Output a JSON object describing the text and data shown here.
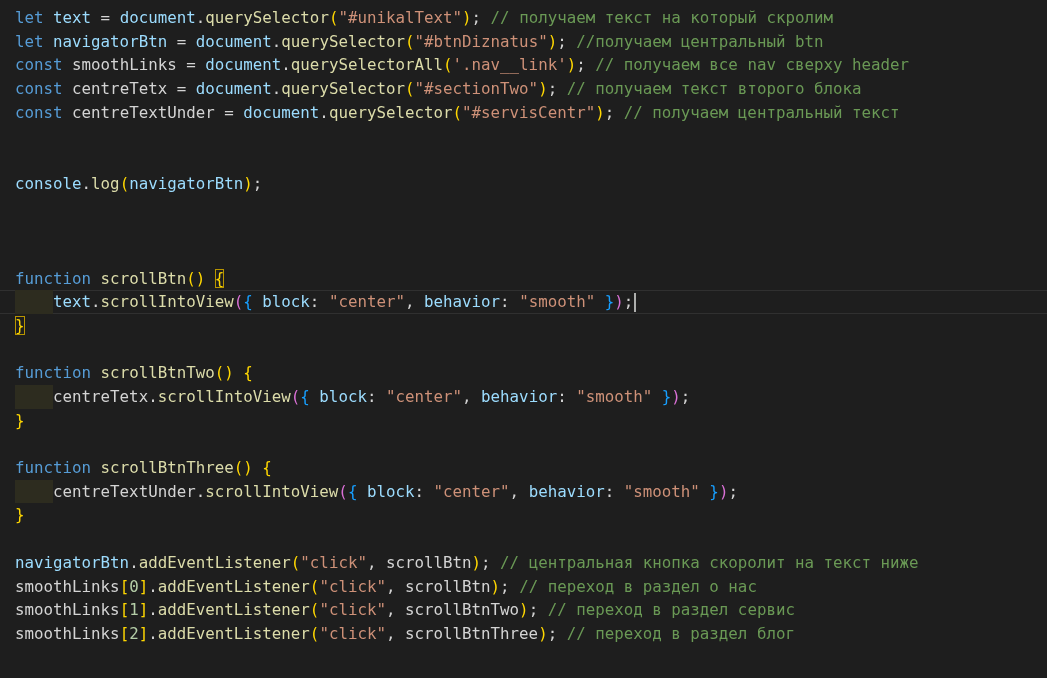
{
  "editor": {
    "lines": [
      {
        "kind": "code",
        "tokens": [
          {
            "kind": "kw",
            "text": "let "
          },
          {
            "kind": "var",
            "text": "text"
          },
          {
            "kind": "plain",
            "text": " = "
          },
          {
            "kind": "var",
            "text": "document"
          },
          {
            "kind": "plain",
            "text": "."
          },
          {
            "kind": "fn",
            "text": "querySelector"
          },
          {
            "kind": "b1",
            "text": "("
          },
          {
            "kind": "str",
            "text": "\"#unikalText\""
          },
          {
            "kind": "b1",
            "text": ")"
          },
          {
            "kind": "plain",
            "text": "; "
          },
          {
            "kind": "com",
            "text": "// получаем текст на который скролим"
          }
        ]
      },
      {
        "kind": "code",
        "tokens": [
          {
            "kind": "kw",
            "text": "let "
          },
          {
            "kind": "var",
            "text": "navigatorBtn"
          },
          {
            "kind": "plain",
            "text": " = "
          },
          {
            "kind": "var",
            "text": "document"
          },
          {
            "kind": "plain",
            "text": "."
          },
          {
            "kind": "fn",
            "text": "querySelector"
          },
          {
            "kind": "b1",
            "text": "("
          },
          {
            "kind": "str",
            "text": "\"#btnDiznatus\""
          },
          {
            "kind": "b1",
            "text": ")"
          },
          {
            "kind": "plain",
            "text": "; "
          },
          {
            "kind": "com",
            "text": "//получаем центральный btn"
          }
        ]
      },
      {
        "kind": "code",
        "tokens": [
          {
            "kind": "kw",
            "text": "const"
          },
          {
            "kind": "plain",
            "text": " smoothLinks = "
          },
          {
            "kind": "var",
            "text": "document"
          },
          {
            "kind": "plain",
            "text": "."
          },
          {
            "kind": "fn",
            "text": "querySelectorAll"
          },
          {
            "kind": "b1",
            "text": "("
          },
          {
            "kind": "str",
            "text": "'.nav__link'"
          },
          {
            "kind": "b1",
            "text": ")"
          },
          {
            "kind": "plain",
            "text": "; "
          },
          {
            "kind": "com",
            "text": "// получаем все nav сверху header"
          }
        ]
      },
      {
        "kind": "code",
        "tokens": [
          {
            "kind": "kw",
            "text": "const"
          },
          {
            "kind": "plain",
            "text": " centreTetx = "
          },
          {
            "kind": "var",
            "text": "document"
          },
          {
            "kind": "plain",
            "text": "."
          },
          {
            "kind": "fn",
            "text": "querySelector"
          },
          {
            "kind": "b1",
            "text": "("
          },
          {
            "kind": "str",
            "text": "\"#sectionTwo\""
          },
          {
            "kind": "b1",
            "text": ")"
          },
          {
            "kind": "plain",
            "text": "; "
          },
          {
            "kind": "com",
            "text": "// получаем текст второго блока"
          }
        ]
      },
      {
        "kind": "code",
        "tokens": [
          {
            "kind": "kw",
            "text": "const"
          },
          {
            "kind": "plain",
            "text": " centreTextUnder = "
          },
          {
            "kind": "var",
            "text": "document"
          },
          {
            "kind": "plain",
            "text": "."
          },
          {
            "kind": "fn",
            "text": "querySelector"
          },
          {
            "kind": "b1",
            "text": "("
          },
          {
            "kind": "str",
            "text": "\"#servisCentr\""
          },
          {
            "kind": "b1",
            "text": ")"
          },
          {
            "kind": "plain",
            "text": "; "
          },
          {
            "kind": "com",
            "text": "// получаем центральный текст"
          }
        ]
      },
      {
        "kind": "blank"
      },
      {
        "kind": "blank"
      },
      {
        "kind": "code",
        "tokens": [
          {
            "kind": "var",
            "text": "console"
          },
          {
            "kind": "plain",
            "text": "."
          },
          {
            "kind": "fn",
            "text": "log"
          },
          {
            "kind": "b1",
            "text": "("
          },
          {
            "kind": "var",
            "text": "navigatorBtn"
          },
          {
            "kind": "b1",
            "text": ")"
          },
          {
            "kind": "plain",
            "text": ";"
          }
        ]
      },
      {
        "kind": "blank"
      },
      {
        "kind": "blank"
      },
      {
        "kind": "blank"
      },
      {
        "kind": "code",
        "tokens": [
          {
            "kind": "kw",
            "text": "function "
          },
          {
            "kind": "fn",
            "text": "scrollBtn"
          },
          {
            "kind": "b1",
            "text": "() "
          },
          {
            "kind": "b1",
            "text": "{",
            "matched": true
          }
        ]
      },
      {
        "kind": "code",
        "indented": true,
        "current": true,
        "tokens": [
          {
            "kind": "var",
            "text": "text"
          },
          {
            "kind": "plain",
            "text": "."
          },
          {
            "kind": "fn",
            "text": "scrollIntoView"
          },
          {
            "kind": "b2",
            "text": "("
          },
          {
            "kind": "b3",
            "text": "{ "
          },
          {
            "kind": "var",
            "text": "block"
          },
          {
            "kind": "plain",
            "text": ": "
          },
          {
            "kind": "str",
            "text": "\"center\""
          },
          {
            "kind": "plain",
            "text": ", "
          },
          {
            "kind": "var",
            "text": "behavior"
          },
          {
            "kind": "plain",
            "text": ": "
          },
          {
            "kind": "str",
            "text": "\"smooth\" "
          },
          {
            "kind": "b3",
            "text": "}"
          },
          {
            "kind": "b2",
            "text": ")"
          },
          {
            "kind": "plain",
            "text": ";"
          }
        ]
      },
      {
        "kind": "code",
        "tokens": [
          {
            "kind": "b1",
            "text": "}",
            "matched": true
          }
        ]
      },
      {
        "kind": "blank"
      },
      {
        "kind": "code",
        "tokens": [
          {
            "kind": "kw",
            "text": "function "
          },
          {
            "kind": "fn",
            "text": "scrollBtnTwo"
          },
          {
            "kind": "b1",
            "text": "() {"
          }
        ]
      },
      {
        "kind": "code",
        "indented": true,
        "tokens": [
          {
            "kind": "plain",
            "text": "centreTetx."
          },
          {
            "kind": "fn",
            "text": "scrollIntoView"
          },
          {
            "kind": "b2",
            "text": "("
          },
          {
            "kind": "b3",
            "text": "{ "
          },
          {
            "kind": "var",
            "text": "block"
          },
          {
            "kind": "plain",
            "text": ": "
          },
          {
            "kind": "str",
            "text": "\"center\""
          },
          {
            "kind": "plain",
            "text": ", "
          },
          {
            "kind": "var",
            "text": "behavior"
          },
          {
            "kind": "plain",
            "text": ": "
          },
          {
            "kind": "str",
            "text": "\"smooth\" "
          },
          {
            "kind": "b3",
            "text": "}"
          },
          {
            "kind": "b2",
            "text": ")"
          },
          {
            "kind": "plain",
            "text": ";"
          }
        ]
      },
      {
        "kind": "code",
        "tokens": [
          {
            "kind": "b1",
            "text": "}"
          }
        ]
      },
      {
        "kind": "blank"
      },
      {
        "kind": "code",
        "tokens": [
          {
            "kind": "kw",
            "text": "function "
          },
          {
            "kind": "fn",
            "text": "scrollBtnThree"
          },
          {
            "kind": "b1",
            "text": "() {"
          }
        ]
      },
      {
        "kind": "code",
        "indented": true,
        "tokens": [
          {
            "kind": "plain",
            "text": "centreTextUnder."
          },
          {
            "kind": "fn",
            "text": "scrollIntoView"
          },
          {
            "kind": "b2",
            "text": "("
          },
          {
            "kind": "b3",
            "text": "{ "
          },
          {
            "kind": "var",
            "text": "block"
          },
          {
            "kind": "plain",
            "text": ": "
          },
          {
            "kind": "str",
            "text": "\"center\""
          },
          {
            "kind": "plain",
            "text": ", "
          },
          {
            "kind": "var",
            "text": "behavior"
          },
          {
            "kind": "plain",
            "text": ": "
          },
          {
            "kind": "str",
            "text": "\"smooth\" "
          },
          {
            "kind": "b3",
            "text": "}"
          },
          {
            "kind": "b2",
            "text": ")"
          },
          {
            "kind": "plain",
            "text": ";"
          }
        ]
      },
      {
        "kind": "code",
        "tokens": [
          {
            "kind": "b1",
            "text": "}"
          }
        ]
      },
      {
        "kind": "blank"
      },
      {
        "kind": "code",
        "tokens": [
          {
            "kind": "var",
            "text": "navigatorBtn"
          },
          {
            "kind": "plain",
            "text": "."
          },
          {
            "kind": "fn",
            "text": "addEventListener"
          },
          {
            "kind": "b1",
            "text": "("
          },
          {
            "kind": "str",
            "text": "\"click\""
          },
          {
            "kind": "plain",
            "text": ", scrollBtn"
          },
          {
            "kind": "b1",
            "text": ")"
          },
          {
            "kind": "plain",
            "text": "; "
          },
          {
            "kind": "com",
            "text": "// центральная кнопка скоролит на текст ниже"
          }
        ]
      },
      {
        "kind": "code",
        "tokens": [
          {
            "kind": "plain",
            "text": "smoothLinks"
          },
          {
            "kind": "b1",
            "text": "["
          },
          {
            "kind": "num",
            "text": "0"
          },
          {
            "kind": "b1",
            "text": "]"
          },
          {
            "kind": "plain",
            "text": "."
          },
          {
            "kind": "fn",
            "text": "addEventListener"
          },
          {
            "kind": "b1",
            "text": "("
          },
          {
            "kind": "str",
            "text": "\"click\""
          },
          {
            "kind": "plain",
            "text": ", scrollBtn"
          },
          {
            "kind": "b1",
            "text": ")"
          },
          {
            "kind": "plain",
            "text": "; "
          },
          {
            "kind": "com",
            "text": "// переход в раздел о нас"
          }
        ]
      },
      {
        "kind": "code",
        "tokens": [
          {
            "kind": "plain",
            "text": "smoothLinks"
          },
          {
            "kind": "b1",
            "text": "["
          },
          {
            "kind": "num",
            "text": "1"
          },
          {
            "kind": "b1",
            "text": "]"
          },
          {
            "kind": "plain",
            "text": "."
          },
          {
            "kind": "fn",
            "text": "addEventListener"
          },
          {
            "kind": "b1",
            "text": "("
          },
          {
            "kind": "str",
            "text": "\"click\""
          },
          {
            "kind": "plain",
            "text": ", scrollBtnTwo"
          },
          {
            "kind": "b1",
            "text": ")"
          },
          {
            "kind": "plain",
            "text": "; "
          },
          {
            "kind": "com",
            "text": "// переход в раздел сервис"
          }
        ]
      },
      {
        "kind": "code",
        "tokens": [
          {
            "kind": "plain",
            "text": "smoothLinks"
          },
          {
            "kind": "b1",
            "text": "["
          },
          {
            "kind": "num",
            "text": "2"
          },
          {
            "kind": "b1",
            "text": "]"
          },
          {
            "kind": "plain",
            "text": "."
          },
          {
            "kind": "fn",
            "text": "addEventListener"
          },
          {
            "kind": "b1",
            "text": "("
          },
          {
            "kind": "str",
            "text": "\"click\""
          },
          {
            "kind": "plain",
            "text": ", scrollBtnThree"
          },
          {
            "kind": "b1",
            "text": ")"
          },
          {
            "kind": "plain",
            "text": "; "
          },
          {
            "kind": "com",
            "text": "// переход в раздел блог"
          }
        ]
      }
    ]
  }
}
